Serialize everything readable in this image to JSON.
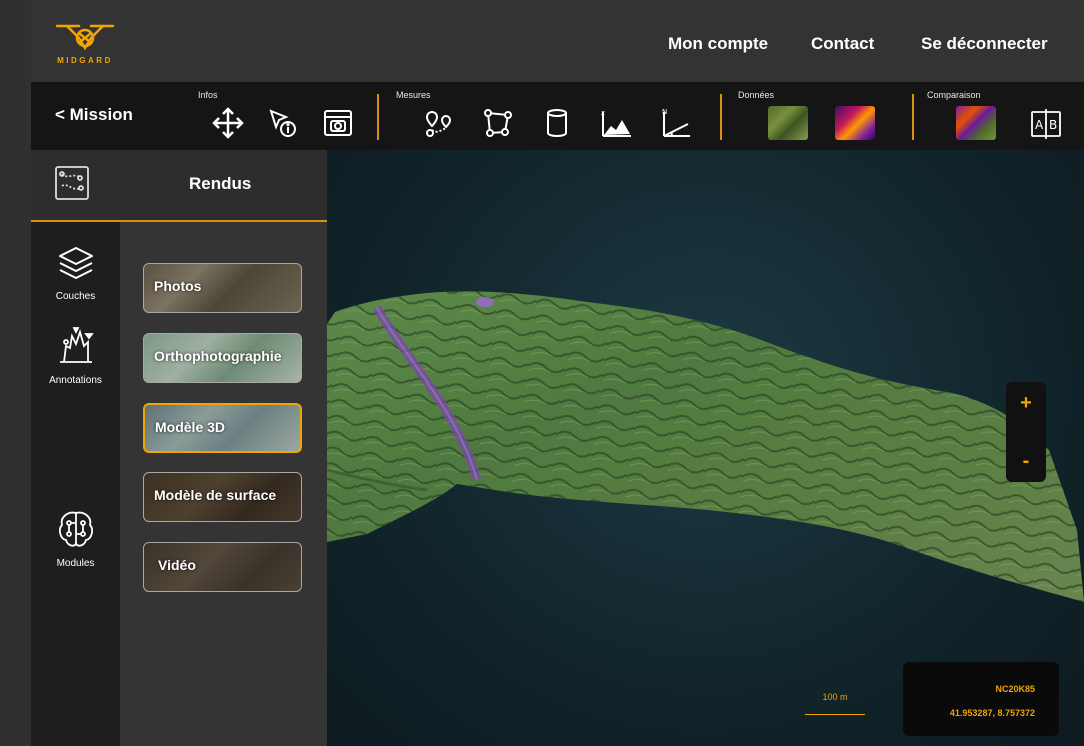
{
  "brand": {
    "name": "MIDGARD",
    "accent": "#f0a500"
  },
  "topnav": {
    "account": "Mon compte",
    "contact": "Contact",
    "logout": "Se déconnecter"
  },
  "toolbar": {
    "back_label": "< Mission",
    "groups": {
      "infos": "Infos",
      "mesures": "Mesures",
      "donnees": "Données",
      "comparaison": "Comparaison"
    },
    "tools": {
      "infos": [
        "move-icon",
        "info-pointer-icon",
        "camera-icon"
      ],
      "mesures": [
        "route-icon",
        "polygon-icon",
        "volume-icon",
        "elevation-profile-icon",
        "angle-icon"
      ],
      "donnees": [
        "ortho-thumbnail",
        "thermal-thumbnail"
      ],
      "comparaison": [
        "compare-thumbnail",
        "ab-compare-icon"
      ]
    }
  },
  "panel": {
    "title": "Rendus"
  },
  "rail": {
    "layers": "Couches",
    "annotations": "Annotations",
    "modules": "Modules"
  },
  "renders": [
    {
      "label": "Photos",
      "active": false
    },
    {
      "label": "Orthophotographie",
      "active": false
    },
    {
      "label": "Modèle 3D",
      "active": true
    },
    {
      "label": "Modèle de surface",
      "active": false
    },
    {
      "label": "Vidéo",
      "active": false
    }
  ],
  "viewer": {
    "zoom_in": "+",
    "zoom_out": "-",
    "scale": "100 m",
    "tile_code": "NC20K85",
    "coordinates": "41.953287, 8.757372"
  }
}
